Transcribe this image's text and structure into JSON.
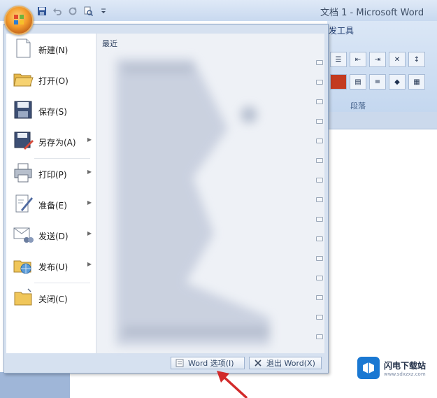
{
  "window": {
    "title": "文档 1 - Microsoft Word"
  },
  "office_button": {
    "icon": "office-logo-icon"
  },
  "quick_access": [
    {
      "name": "save-icon"
    },
    {
      "name": "undo-icon"
    },
    {
      "name": "redo-icon"
    },
    {
      "name": "print-preview-icon"
    },
    {
      "name": "customize-dropdown-icon"
    }
  ],
  "ribbon": {
    "tab_partial": "发工具",
    "group_label": "段落"
  },
  "menu": {
    "items": [
      {
        "label": "新建(N)",
        "icon": "new-document-icon",
        "submenu": false
      },
      {
        "label": "打开(O)",
        "icon": "open-folder-icon",
        "submenu": false
      },
      {
        "label": "保存(S)",
        "icon": "save-icon",
        "submenu": false
      },
      {
        "label": "另存为(A)",
        "icon": "save-as-icon",
        "submenu": true
      },
      {
        "label": "打印(P)",
        "icon": "printer-icon",
        "submenu": true
      },
      {
        "label": "准备(E)",
        "icon": "prepare-icon",
        "submenu": true
      },
      {
        "label": "发送(D)",
        "icon": "send-icon",
        "submenu": true
      },
      {
        "label": "发布(U)",
        "icon": "publish-icon",
        "submenu": true
      },
      {
        "label": "关闭(C)",
        "icon": "close-folder-icon",
        "submenu": false
      }
    ],
    "recent": {
      "header": "最近"
    },
    "options_button": "Word 选项(I)",
    "exit_button": "退出 Word(X)"
  },
  "watermark": {
    "name": "闪电下载站",
    "url": "www.sdxzxz.com"
  },
  "colors": {
    "accent": "#c8d9ef",
    "menu_bg": "#d6e1f0",
    "annotation": "#d22a2a"
  }
}
